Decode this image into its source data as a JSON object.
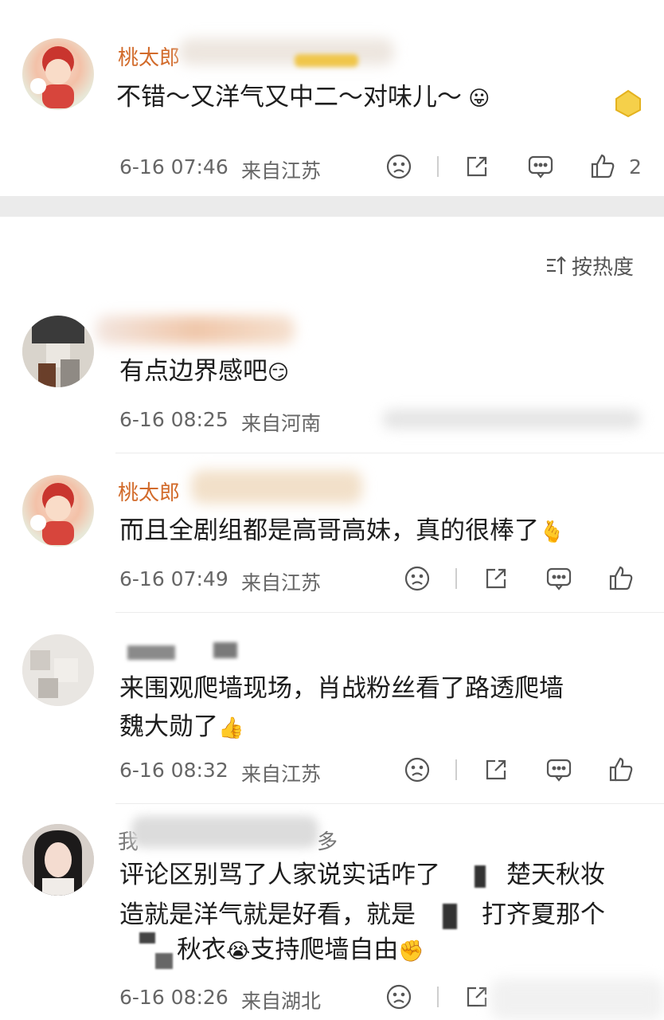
{
  "sort_label": "按热度",
  "pinned": {
    "name_visible": "桃太郎",
    "text": "不错～又洋气又中二～对味儿～",
    "time": "6-16 07:46",
    "location": "来自江苏",
    "like_count": "2"
  },
  "comments": [
    {
      "text": "有点边界感吧",
      "time": "6-16 08:25",
      "location": "来自河南"
    },
    {
      "name_visible": "桃太郎",
      "text": "而且全剧组都是高哥高妹，真的很棒了",
      "time": "6-16 07:49",
      "location": "来自江苏"
    },
    {
      "text_line1": "来围观爬墙现场，肖战粉丝看了路透爬墙",
      "text_line2": "魏大勋了",
      "time": "6-16 08:32",
      "location": "来自江苏"
    },
    {
      "name_prefix": "我",
      "name_suffix": "多",
      "text_line1_a": "评论区别骂了人家说实话咋了",
      "text_line1_b": "楚天秋妆",
      "text_line2_a": "造就是洋气就是好看，就是",
      "text_line2_b": "打齐夏那个",
      "text_line3": "秋衣",
      "text_line3_b": "支持爬墙自由",
      "time": "6-16 08:26",
      "location": "来自湖北"
    }
  ],
  "icons": {
    "dislike": "frown-icon",
    "share": "share-icon",
    "comment": "comment-icon",
    "like": "thumbs-up-icon",
    "sort": "sort-icon"
  }
}
